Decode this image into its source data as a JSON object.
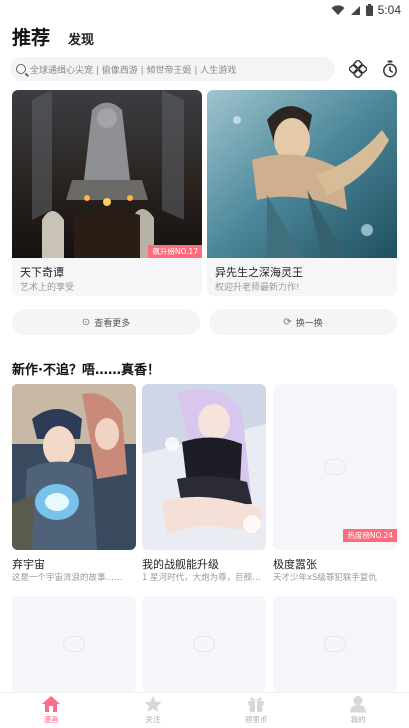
{
  "status_bar": {
    "time": "5:04"
  },
  "top_nav": {
    "recommend": "推荐",
    "discover": "发现"
  },
  "search": {
    "placeholder": "全球通缉心尖宠 | 偷像西游 | 倾世帝王姬 | 人生游戏"
  },
  "featured": [
    {
      "title": "天下奇谭",
      "subtitle": "艺术上的享受",
      "badge": "飙升榜NO.17"
    },
    {
      "title": "异先生之深海灵王",
      "subtitle": "权迎升老师最新力作!",
      "badge": ""
    }
  ],
  "actions": {
    "more": "查看更多",
    "swap": "换一换"
  },
  "section": {
    "title": "新作·不追？唔……真香！"
  },
  "grid": [
    {
      "title": "弃宇宙",
      "subtitle": "这是一个宇宙流浪的故事……",
      "badge": ""
    },
    {
      "title": "我的战舰能升级",
      "subtitle": "1 星河时代，大炮为尊，巨舰…",
      "badge": ""
    },
    {
      "title": "极度嚣张",
      "subtitle": "天才少年xS级罪犯联手复仇",
      "badge": "热度榜NO.24"
    }
  ],
  "bottom_nav": [
    {
      "label": "漫画",
      "icon": "home-icon",
      "active": true
    },
    {
      "label": "关注",
      "icon": "star-icon",
      "active": false
    },
    {
      "label": "领里币",
      "icon": "gift-icon",
      "active": false
    },
    {
      "label": "我的",
      "icon": "user-icon",
      "active": false
    }
  ],
  "colors": {
    "accent": "#ff6b8a",
    "badge": "#ff6b7d",
    "placeholder_bg": "#f5f6fa"
  }
}
